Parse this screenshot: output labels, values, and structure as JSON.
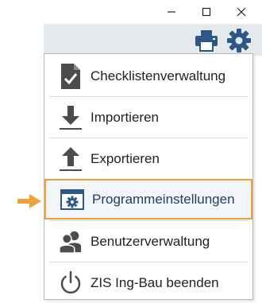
{
  "window": {
    "controls": [
      "minimize-icon",
      "maximize-icon",
      "close-icon"
    ]
  },
  "toolbar": {
    "buttons": [
      "printer-icon",
      "gear-icon"
    ]
  },
  "menu": {
    "items": [
      {
        "label": "Checklistenverwaltung",
        "icon": "checklist-icon"
      },
      {
        "label": "Importieren",
        "icon": "import-icon"
      },
      {
        "label": "Exportieren",
        "icon": "export-icon"
      },
      {
        "label": "Programmeinstellungen",
        "icon": "settings-window-icon",
        "highlighted": true
      },
      {
        "label": "Benutzerverwaltung",
        "icon": "users-icon"
      },
      {
        "label": "ZIS Ing-Bau beenden",
        "icon": "power-icon"
      }
    ]
  },
  "colors": {
    "accent": "#2d5786",
    "highlight": "#f0a03a",
    "toolbar_bg": "#e3e9ec"
  }
}
